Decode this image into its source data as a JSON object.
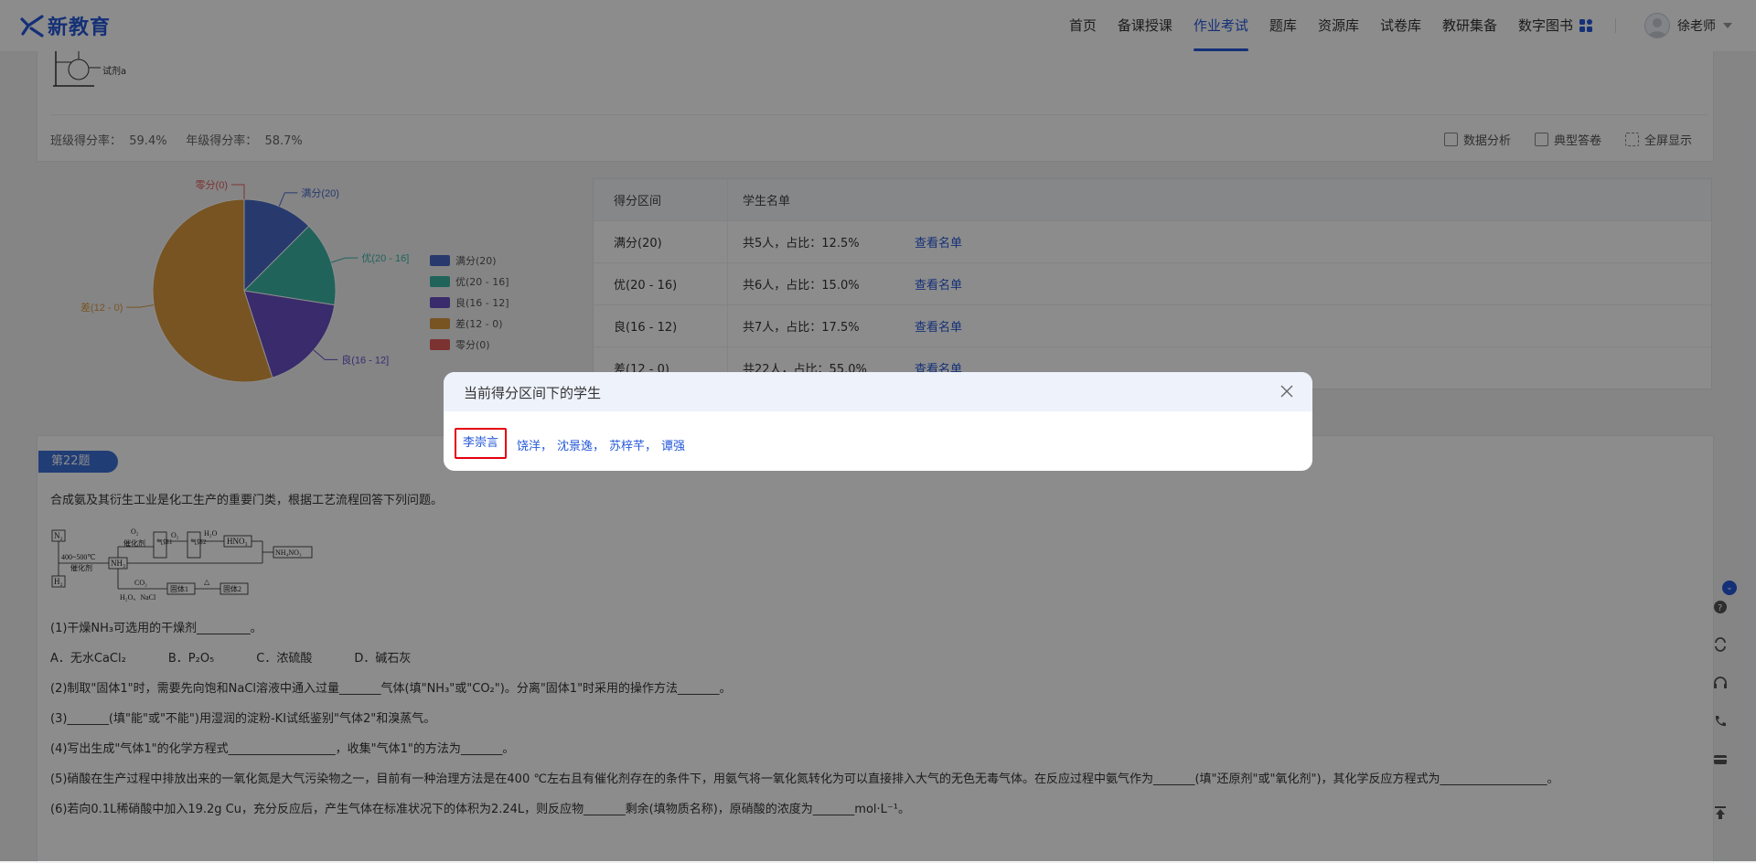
{
  "brand": {
    "name": "新教育",
    "accent": "#2558d9"
  },
  "nav": {
    "items": [
      "首页",
      "备课授课",
      "作业考试",
      "题库",
      "资源库",
      "试卷库",
      "教研集备",
      "数字图书"
    ],
    "active": "作业考试"
  },
  "user": {
    "name": "徐老师"
  },
  "figure_caption": "试剂a",
  "rates": {
    "text": "班级得分率：  59.4%     年级得分率：  58.7%"
  },
  "tools": {
    "analysis": "数据分析",
    "typical": "典型答卷",
    "fullscreen": "全屏显示"
  },
  "chart_data": {
    "type": "pie",
    "categories": [
      "满分(20)",
      "优(20 - 16]",
      "良(16 - 12]",
      "差(12 - 0)",
      "零分(0)"
    ],
    "values": [
      5,
      6,
      7,
      22,
      0
    ],
    "colors": [
      "#4a6bc7",
      "#3bb5a5",
      "#6b4fc5",
      "#d99a3e",
      "#e35b5b"
    ],
    "legend": [
      "满分(20)",
      "优(20 - 16]",
      "良(16 - 12]",
      "差(12 - 0)",
      "零分(0)"
    ],
    "labels": [
      "满分(20)",
      "优(20 - 16]",
      "良(16 - 12]",
      "差(12 - 0)",
      "零分(0)"
    ]
  },
  "table": {
    "headers": [
      "得分区间",
      "学生名单"
    ],
    "rows": [
      {
        "range": "满分(20)",
        "stat": "共5人，占比：12.5%",
        "link": "查看名单"
      },
      {
        "range": "优(20 - 16)",
        "stat": "共6人，占比：15.0%",
        "link": "查看名单"
      },
      {
        "range": "良(16 - 12)",
        "stat": "共7人，占比：17.5%",
        "link": "查看名单"
      },
      {
        "range": "差(12 - 0)",
        "stat": "共22人，占比：55.0%",
        "link": "查看名单"
      }
    ]
  },
  "question": {
    "tag": "第22题",
    "stem": "合成氨及其衍生工业是化工生产的重要门类，根据工艺流程回答下列问题。",
    "q1": "(1)干燥NH₃可选用的干燥剂_________。",
    "q1_options": [
      "A．无水CaCl₂",
      "B．P₂O₅",
      "C．浓硫酸",
      "D．碱石灰"
    ],
    "q2": "(2)制取\"固体1\"时，需要先向饱和NaCl溶液中通入过量_______气体(填\"NH₃\"或\"CO₂\")。分离\"固体1\"时采用的操作方法_______。",
    "q3": "(3)_______(填\"能\"或\"不能\")用湿润的淀粉-KI试纸鉴别\"气体2\"和溴蒸气。",
    "q4": "(4)写出生成\"气体1\"的化学方程式__________________，收集\"气体1\"的方法为_______。",
    "q5": "(5)硝酸在生产过程中排放出来的一氧化氮是大气污染物之一，目前有一种治理方法是在400 ℃左右且有催化剂存在的条件下，用氨气将一氧化氮转化为可以直接排入大气的无色无毒气体。在反应过程中氨气作为_______(填\"还原剂\"或\"氧化剂\")，其化学反应方程式为__________________。",
    "q6": "(6)若向0.1L稀硝酸中加入19.2g Cu，充分反应后，产生气体在标准状况下的体积为2.24L，则反应物_______剩余(填物质名称)，原硝酸的浓度为_______mol·L⁻¹。"
  },
  "flow": {
    "n2": "N₂",
    "h2": "H₂",
    "cond1": "400~500℃",
    "cat1": "催化剂",
    "nh3": "NH₃",
    "o2a": "O₂",
    "cat2": "催化剂",
    "gas1": "气体1",
    "o2b": "O₂",
    "gas2": "气体2",
    "h2o": "H₂O",
    "hno3": "HNO₃",
    "nh4no3": "NH₄NO₃",
    "co2": "CO₂",
    "h2onacl": "H₂O、NaCl",
    "solid1": "固体1",
    "delta": "△",
    "solid2": "固体2"
  },
  "modal": {
    "title": "当前得分区间下的学生",
    "students": [
      "李崇言",
      "饶洋，",
      "沈景逸，",
      "苏梓芊，",
      "谭强"
    ]
  }
}
